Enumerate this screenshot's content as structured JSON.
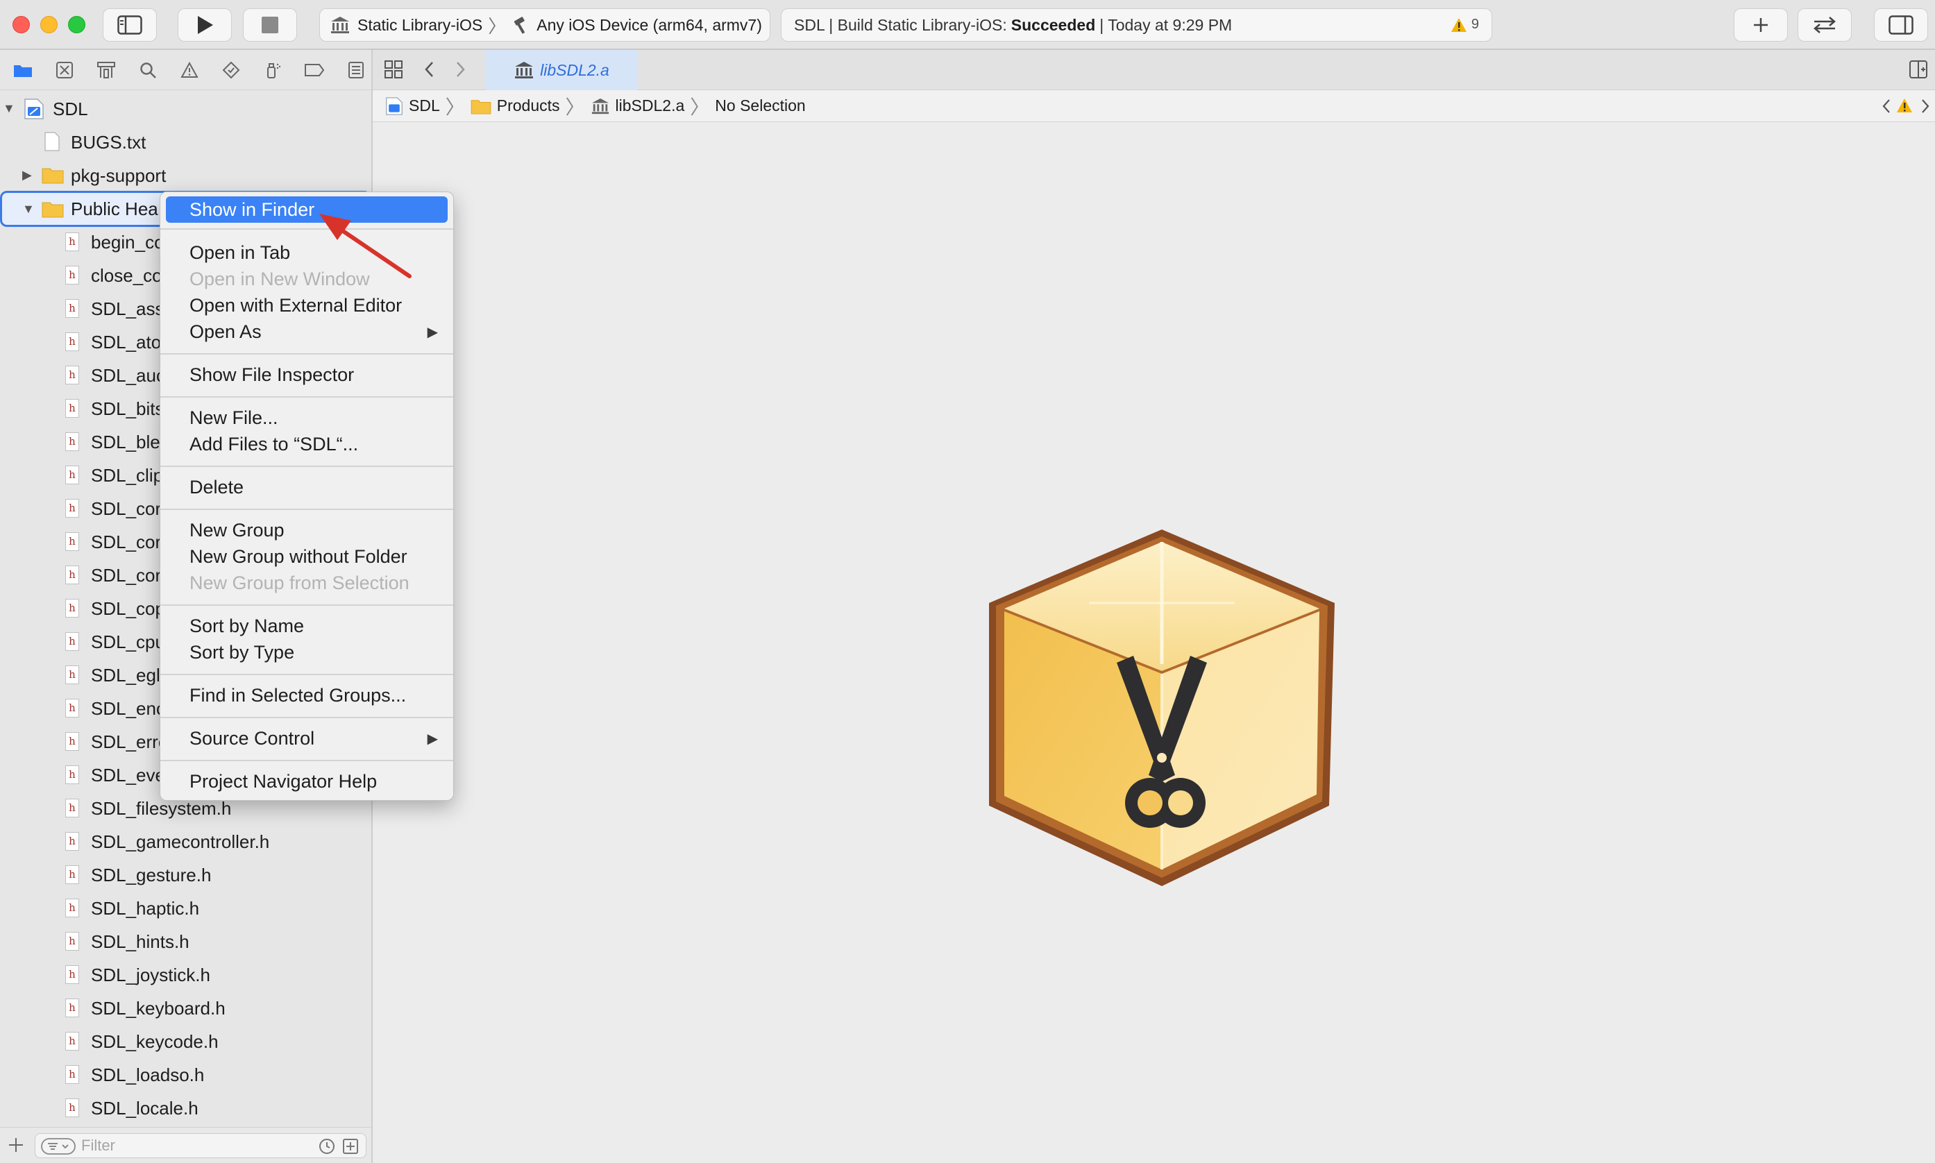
{
  "toolbar": {
    "scheme": "Static Library-iOS",
    "destination": "Any iOS Device (arm64, armv7)",
    "status_prefix": "SDL | Build Static Library-iOS:",
    "status_result": "Succeeded",
    "status_suffix": "| Today at 9:29 PM",
    "warning_count": "9"
  },
  "navigator": {
    "items": [
      {
        "label": "SDL"
      },
      {
        "label": "BUGS.txt"
      },
      {
        "label": "pkg-support"
      },
      {
        "label": "Public Hea"
      },
      {
        "label": "begin_co"
      },
      {
        "label": "close_co"
      },
      {
        "label": "SDL_ass"
      },
      {
        "label": "SDL_ato"
      },
      {
        "label": "SDL_auc"
      },
      {
        "label": "SDL_bits"
      },
      {
        "label": "SDL_ble"
      },
      {
        "label": "SDL_clip"
      },
      {
        "label": "SDL_cor"
      },
      {
        "label": "SDL_cor"
      },
      {
        "label": "SDL_cor"
      },
      {
        "label": "SDL_cop"
      },
      {
        "label": "SDL_cpu"
      },
      {
        "label": "SDL_egl"
      },
      {
        "label": "SDL_enc"
      },
      {
        "label": "SDL_erro"
      },
      {
        "label": "SDL_eve"
      },
      {
        "label": "SDL_filesystem.h"
      },
      {
        "label": "SDL_gamecontroller.h"
      },
      {
        "label": "SDL_gesture.h"
      },
      {
        "label": "SDL_haptic.h"
      },
      {
        "label": "SDL_hints.h"
      },
      {
        "label": "SDL_joystick.h"
      },
      {
        "label": "SDL_keyboard.h"
      },
      {
        "label": "SDL_keycode.h"
      },
      {
        "label": "SDL_loadso.h"
      },
      {
        "label": "SDL_locale.h"
      }
    ],
    "filter_placeholder": "Filter"
  },
  "editor": {
    "tab_label": "libSDL2.a",
    "breadcrumb": [
      "SDL",
      "Products",
      "libSDL2.a",
      "No Selection"
    ]
  },
  "context_menu": {
    "items": [
      {
        "label": "Show in Finder"
      },
      {
        "label": "Open in Tab"
      },
      {
        "label": "Open in New Window"
      },
      {
        "label": "Open with External Editor"
      },
      {
        "label": "Open As"
      },
      {
        "label": "Show File Inspector"
      },
      {
        "label": "New File..."
      },
      {
        "label": "Add Files to “SDL“..."
      },
      {
        "label": "Delete"
      },
      {
        "label": "New Group"
      },
      {
        "label": "New Group without Folder"
      },
      {
        "label": "New Group from Selection"
      },
      {
        "label": "Sort by Name"
      },
      {
        "label": "Sort by Type"
      },
      {
        "label": "Find in Selected Groups..."
      },
      {
        "label": "Source Control"
      },
      {
        "label": "Project Navigator Help"
      }
    ]
  },
  "colors": {
    "highlight": "#3a82f6",
    "selection_border": "#3b7ae8",
    "annotation_arrow": "#d8332a"
  },
  "icons": {
    "product": "static-library-scissors-box-icon"
  }
}
